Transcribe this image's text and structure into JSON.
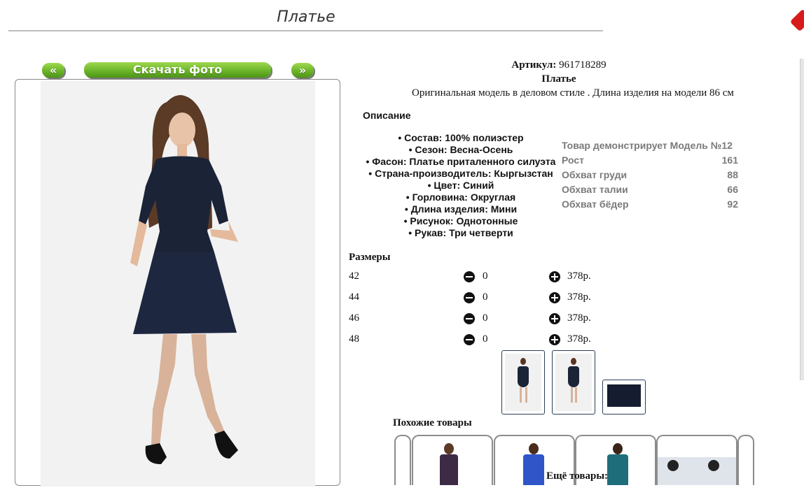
{
  "page": {
    "title": "Платье"
  },
  "gallery": {
    "prev_label": "«",
    "next_label": "»",
    "download_label": "Скачать фото"
  },
  "product": {
    "sku_label": "Артикул:",
    "sku_value": "961718289",
    "name": "Платье",
    "description": "Оригинальная модель в деловом стиле . Длина изделия на модели 86 см",
    "description_heading": "Описание",
    "attributes": [
      "• Состав: 100% полиэстер",
      "• Сезон: Весна-Осень",
      "• Фасон: Платье приталенного силуэта",
      "• Страна-производитель: Кыргызстан",
      "• Цвет: Синий",
      "• Горловина: Округлая",
      "• Длина изделия: Мини",
      "• Рисунок: Однотонные",
      "• Рукав: Три четверти"
    ]
  },
  "model": {
    "heading": "Товар демонстрирует Модель №12",
    "params": [
      {
        "label": "Рост",
        "value": "161"
      },
      {
        "label": "Обхват груди",
        "value": "88"
      },
      {
        "label": "Обхват талии",
        "value": "66"
      },
      {
        "label": "Обхват бёдер",
        "value": "92"
      }
    ]
  },
  "sizes": {
    "heading": "Размеры",
    "rows": [
      {
        "size": "42",
        "qty": "0",
        "price": "378р."
      },
      {
        "size": "44",
        "qty": "0",
        "price": "378р."
      },
      {
        "size": "46",
        "qty": "0",
        "price": "378р."
      },
      {
        "size": "48",
        "qty": "0",
        "price": "378р."
      }
    ]
  },
  "colors": {
    "dress": "#1b2337",
    "accent_green": "#6cb52a",
    "frame": "#2b3f57"
  },
  "similar": {
    "heading": "Похожие товары"
  },
  "more": {
    "heading": "Ещё товары:"
  }
}
